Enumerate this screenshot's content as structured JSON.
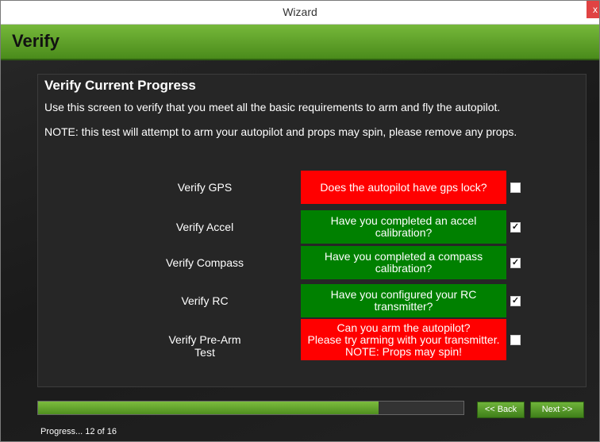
{
  "window": {
    "title": "Wizard",
    "close_glyph": "x"
  },
  "header": {
    "title": "Verify"
  },
  "panel": {
    "title": "Verify Current Progress",
    "description": "Use this screen to verify that you meet all the basic requirements to arm and fly the autopilot.",
    "note": "NOTE: this test will attempt to arm your autopilot and props may spin, please remove any props."
  },
  "checks": [
    {
      "label": "Verify GPS",
      "lines": [
        "Does the autopilot have gps lock?"
      ],
      "status": "red",
      "checked": false
    },
    {
      "label": "Verify Accel",
      "lines": [
        "Have you completed an accel",
        "calibration?"
      ],
      "status": "green",
      "checked": true
    },
    {
      "label": "Verify Compass",
      "lines": [
        "Have you completed a compass",
        "calibration?"
      ],
      "status": "green",
      "checked": true
    },
    {
      "label": "Verify RC",
      "lines": [
        "Have you configured your RC",
        "transmitter?"
      ],
      "status": "green",
      "checked": true
    },
    {
      "label": "Verify Pre-Arm Test",
      "lines": [
        "Can you arm the autopilot?",
        "Please try arming with your transmitter.",
        "NOTE: Props may spin!"
      ],
      "status": "red",
      "checked": false
    }
  ],
  "colors": {
    "red": "#ff0000",
    "green": "#008000",
    "accent": "#5a9e2a"
  },
  "progress": {
    "fraction": 0.8,
    "text": "Progress... 12 of 16"
  },
  "buttons": {
    "back": "<< Back",
    "next": "Next >>"
  }
}
